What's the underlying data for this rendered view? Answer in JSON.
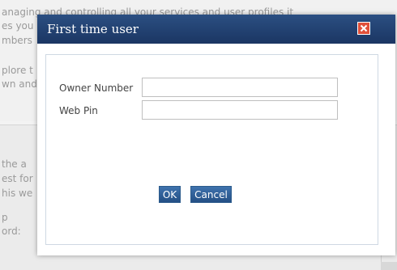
{
  "background": {
    "lines": [
      "anaging and controlling all your services and user profiles it",
      "es you",
      "mbers",
      "plore t",
      "wn and",
      "the a",
      "est for",
      "his we",
      "p",
      "ord:"
    ]
  },
  "dialog": {
    "title": "First time user",
    "fields": [
      {
        "label": "Owner Number",
        "value": "",
        "placeholder": ""
      },
      {
        "label": "Web Pin",
        "value": "",
        "placeholder": ""
      }
    ],
    "buttons": {
      "ok": "OK",
      "cancel": "Cancel"
    }
  },
  "colors": {
    "titlebar": "#1f3b6b",
    "button": "#2f5f96",
    "close": "#e0503a"
  }
}
